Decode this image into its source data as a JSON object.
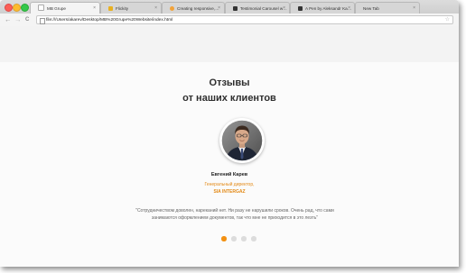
{
  "browser": {
    "tabs": [
      {
        "label": "MB Grupe",
        "favicon_color": "#ffffff"
      },
      {
        "label": "Flickity",
        "favicon_color": "#e8b020"
      },
      {
        "label": "Creating responsive, touch",
        "favicon_color": "#f2a33a"
      },
      {
        "label": "Testimonial Carousel with",
        "favicon_color": "#333333"
      },
      {
        "label": "A Pen by Aleksandr Karev",
        "favicon_color": "#333333"
      },
      {
        "label": "New Tab",
        "favicon_color": ""
      }
    ],
    "active_tab_index": 0,
    "tab_close_glyph": "×",
    "back_glyph": "←",
    "forward_glyph": "→",
    "reload_glyph": "C",
    "url": "file:///Users/akarev/Desktop/MB%20Grupe%20Website/index.html",
    "star_glyph": "☆"
  },
  "page": {
    "heading_line1": "Отзывы",
    "heading_line2": "от наших клиентов",
    "testimonial": {
      "name": "Евгений Карев",
      "role": "Генеральный директор,",
      "company": "SIA INTERGAZ",
      "quote": "\"Сотрудничеством доволен, нареканий нет. Ни разу не нарушили сроков. Очень рад, что сами занимаются оформлением документов, так что мне не приходится в это лезть\""
    },
    "carousel": {
      "slides": 4,
      "active_index": 0
    }
  },
  "colors": {
    "accent": "#f39012",
    "role_text": "#e38a17",
    "heading": "#2e2e2e"
  }
}
